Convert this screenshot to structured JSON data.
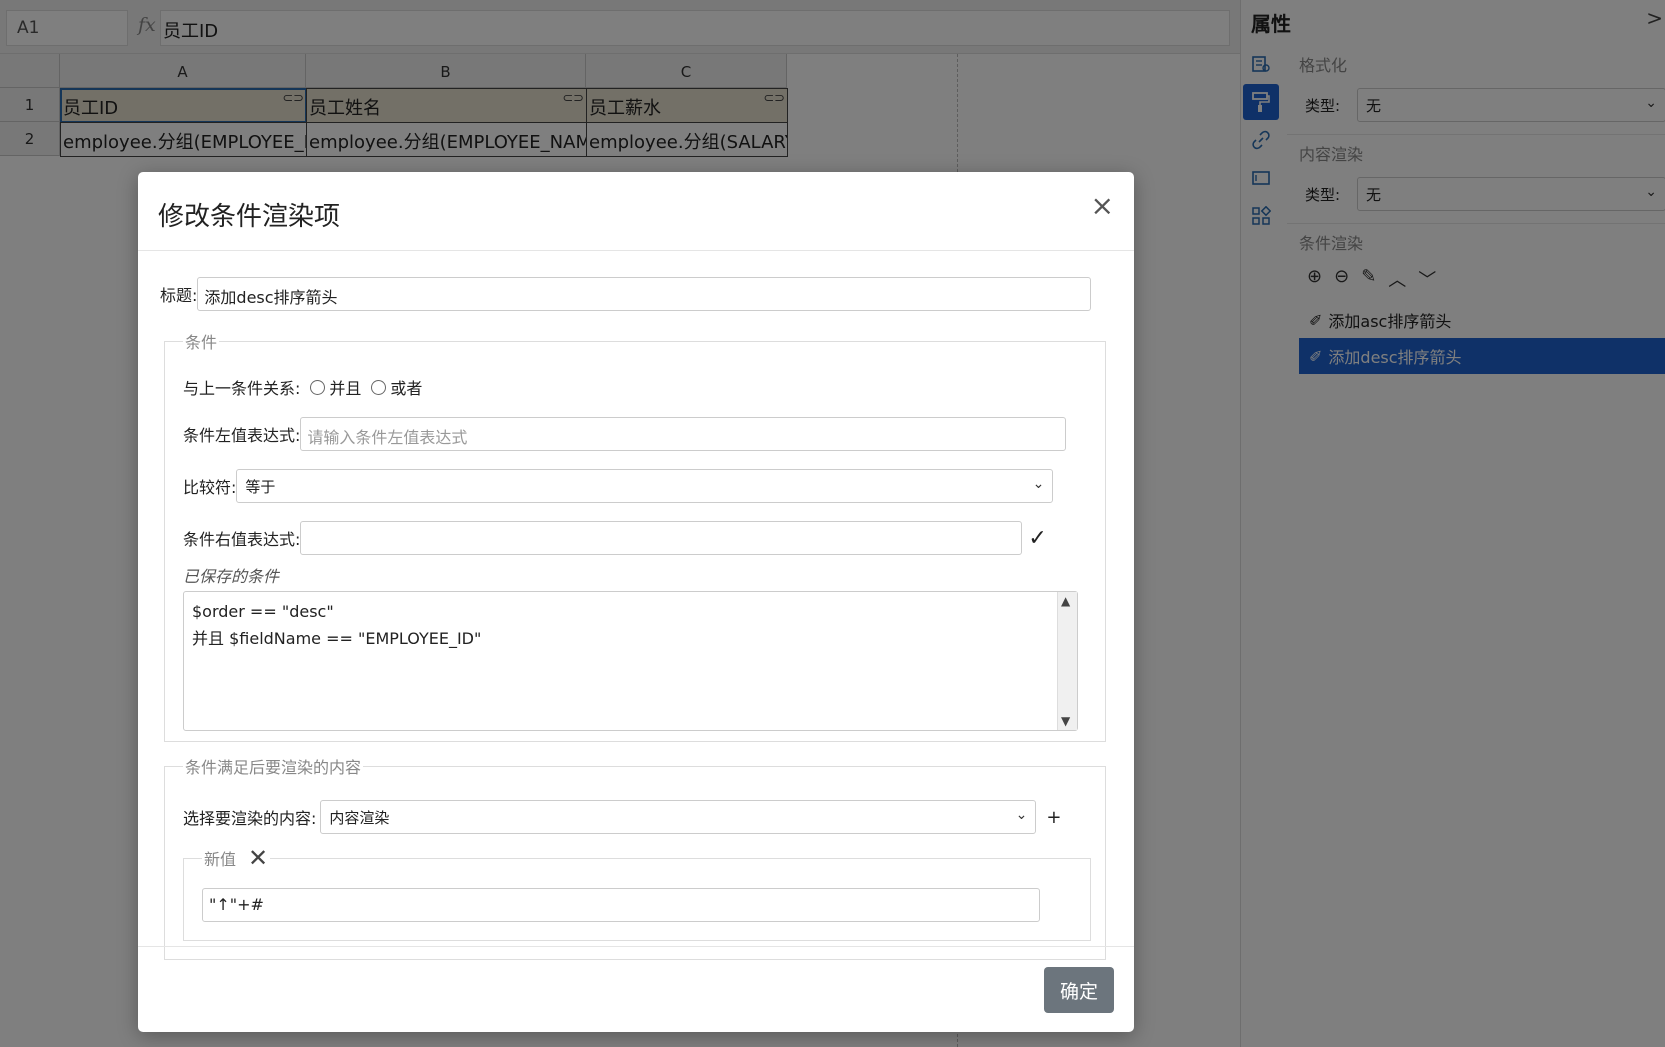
{
  "formula_bar": {
    "cell_ref": "A1",
    "fx": "fx",
    "value": "员工ID"
  },
  "grid": {
    "columns": [
      "A",
      "B",
      "C"
    ],
    "rows": [
      "1",
      "2"
    ],
    "header_cells": [
      "员工ID",
      "员工姓名",
      "员工薪水"
    ],
    "data_cells": [
      "employee.分组(EMPLOYEE_ID)",
      "employee.分组(EMPLOYEE_NAME)",
      "employee.分组(SALARY)"
    ]
  },
  "side_panel": {
    "title": "属性",
    "close": ">",
    "format": {
      "title": "格式化",
      "type_label": "类型:",
      "type_value": "无"
    },
    "content_render": {
      "title": "内容渲染",
      "type_label": "类型:",
      "type_value": "无"
    },
    "cond_render": {
      "title": "条件渲染",
      "items": [
        "添加asc排序箭头",
        "添加desc排序箭头"
      ]
    }
  },
  "modal": {
    "title": "修改条件渲染项",
    "close": "×",
    "title_label": "标题:",
    "title_value": "添加desc排序箭头",
    "condition": {
      "legend": "条件",
      "relation_label": "与上一条件关系:",
      "relation_and": "并且",
      "relation_or": "或者",
      "left_label": "条件左值表达式:",
      "left_placeholder": "请输入条件左值表达式",
      "op_label": "比较符:",
      "op_value": "等于",
      "right_label": "条件右值表达式:",
      "right_value": "",
      "saved_label": "已保存的条件",
      "saved_lines": [
        "$order == \"desc\"",
        "并且 $fieldName == \"EMPLOYEE_ID\""
      ]
    },
    "render": {
      "legend": "条件满足后要渲染的内容",
      "select_label": "选择要渲染的内容:",
      "select_value": "内容渲染",
      "add": "+",
      "newval_legend": "新值",
      "newval_value": "\"↑\"+#"
    },
    "ok": "确定"
  }
}
